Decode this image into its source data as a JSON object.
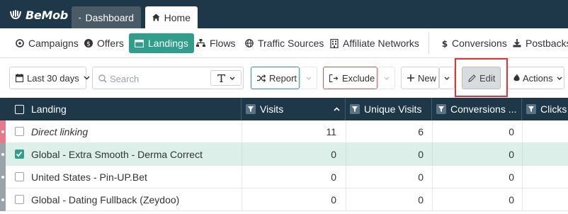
{
  "app": {
    "logo": "BeMob",
    "tabs": [
      {
        "label": "Dashboard",
        "icon": "dashboard-gauge-icon"
      },
      {
        "label": "Home",
        "icon": "home-icon"
      }
    ]
  },
  "nav": {
    "items": [
      {
        "label": "Campaigns",
        "icon": "campaigns-icon"
      },
      {
        "label": "Offers",
        "icon": "offers-dollar-icon"
      },
      {
        "label": "Landings",
        "icon": "landings-window-icon",
        "active": true
      },
      {
        "label": "Flows",
        "icon": "flows-sitemap-icon"
      },
      {
        "label": "Traffic Sources",
        "icon": "globe-icon"
      },
      {
        "label": "Affiliate Networks",
        "icon": "building-icon"
      },
      {
        "label": "Conversions",
        "icon": "dollar-icon"
      },
      {
        "label": "Postbacks",
        "icon": "download-icon"
      }
    ]
  },
  "toolbar": {
    "date_range": "Last 30 days",
    "search_placeholder": "Search",
    "report": "Report",
    "exclude": "Exclude",
    "new": "New",
    "edit": "Edit",
    "actions": "Actions"
  },
  "table": {
    "columns": [
      "Landing",
      "Visits",
      "Unique Visits",
      "Conversions ...",
      "Clicks"
    ],
    "rows": [
      {
        "name": "Direct linking",
        "visits": "11",
        "unique_visits": "6",
        "conversions": "0",
        "italic": true,
        "checked": false
      },
      {
        "name": "Global - Extra Smooth - Derma Correct",
        "visits": "0",
        "unique_visits": "0",
        "conversions": "0",
        "italic": false,
        "checked": true
      },
      {
        "name": "United States - Pin-UP.Bet",
        "visits": "0",
        "unique_visits": "0",
        "conversions": "0",
        "italic": false,
        "checked": false
      },
      {
        "name": "Global - Dating Fullback (Zeydoo)",
        "visits": "0",
        "unique_visits": "0",
        "conversions": "0",
        "italic": false,
        "checked": false
      }
    ]
  },
  "colors": {
    "header_bg": "#1e3849",
    "accent_green": "#2f9e8a",
    "exclude_red": "#e05353",
    "highlight_red": "#e8322f",
    "selected_row": "#dcefe9"
  }
}
